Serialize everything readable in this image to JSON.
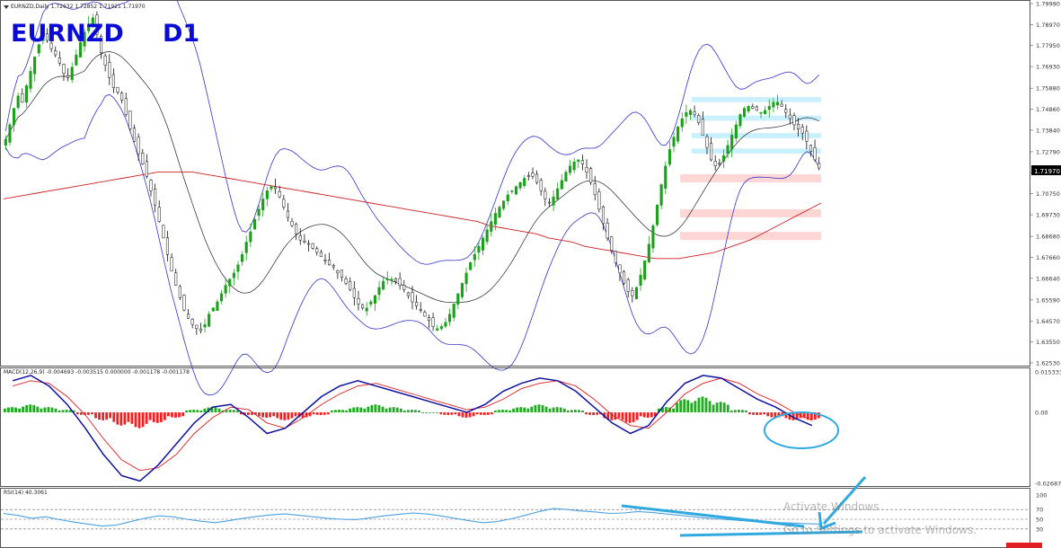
{
  "symbol_label": "EURNZD",
  "timeframe_label": "D1",
  "main_panel": {
    "title": "EURNZD,Daily",
    "ohlc": "1.72632 1.72852 1.71921 1.71970",
    "current_price": "1.71970",
    "price_ticks": [
      "1.79990",
      "1.78970",
      "1.77950",
      "1.76930",
      "1.75880",
      "1.74860",
      "1.73840",
      "1.72790",
      "1.71770",
      "1.70750",
      "1.69730",
      "1.68680",
      "1.67660",
      "1.66640",
      "1.65590",
      "1.64570",
      "1.63550",
      "1.62530"
    ]
  },
  "macd_panel": {
    "label": "MACD(12,26,9) -0.004693 -0.003515 0.000000 -0.001178 -0.001178",
    "ticks": [
      "0.015333",
      "0.00",
      "-0.026879"
    ]
  },
  "rsi_panel": {
    "label": "RSI(14) 40.3061",
    "ticks": [
      "100",
      "70",
      "50",
      "30"
    ]
  },
  "watermark": {
    "line1": "Activate Windows",
    "line2": "Go to Settings to activate Windows."
  },
  "colors": {
    "bull_candle": "#1aa01a",
    "bear_candle": "#111111",
    "bollinger": "#3333cc",
    "sma_long": "#cc2020",
    "macd_line": "#1010a0",
    "signal_line": "#e02020",
    "macd_hist_pos": "#22aa22",
    "macd_hist_neg": "#ee2222",
    "rsi_line": "#4aa0e0",
    "annotation": "#30a8e0",
    "resistance_zone": "#c8f0ff",
    "support_zone": "#ffd6d6",
    "label_blue": "#0a0ad8"
  },
  "chart_data": [
    {
      "type": "candlestick",
      "panel": "price",
      "title": "EURNZD,Daily",
      "ylim": [
        1.6253,
        1.7999
      ],
      "close": [
        1.734,
        1.741,
        1.749,
        1.755,
        1.752,
        1.76,
        1.767,
        1.774,
        1.78,
        1.785,
        1.782,
        1.778,
        1.775,
        1.771,
        1.766,
        1.764,
        1.769,
        1.775,
        1.781,
        1.786,
        1.79,
        1.793,
        1.785,
        1.776,
        1.77,
        1.764,
        1.759,
        1.757,
        1.753,
        1.746,
        1.739,
        1.733,
        1.727,
        1.722,
        1.716,
        1.709,
        1.702,
        1.694,
        1.686,
        1.678,
        1.67,
        1.663,
        1.657,
        1.651,
        1.647,
        1.644,
        1.642,
        1.641,
        1.644,
        1.649,
        1.652,
        1.655,
        1.659,
        1.663,
        1.666,
        1.669,
        1.673,
        1.678,
        1.684,
        1.689,
        1.695,
        1.7,
        1.705,
        1.709,
        1.711,
        1.71,
        1.706,
        1.701,
        1.696,
        1.692,
        1.688,
        1.685,
        1.684,
        1.683,
        1.681,
        1.679,
        1.677,
        1.675,
        1.673,
        1.672,
        1.669,
        1.667,
        1.664,
        1.661,
        1.657,
        1.654,
        1.652,
        1.652,
        1.655,
        1.658,
        1.662,
        1.665,
        1.666,
        1.666,
        1.665,
        1.663,
        1.661,
        1.658,
        1.655,
        1.653,
        1.651,
        1.648,
        1.646,
        1.643,
        1.642,
        1.643,
        1.645,
        1.649,
        1.654,
        1.659,
        1.664,
        1.669,
        1.674,
        1.678,
        1.682,
        1.686,
        1.69,
        1.694,
        1.698,
        1.701,
        1.704,
        1.707,
        1.709,
        1.711,
        1.713,
        1.715,
        1.716,
        1.716,
        1.713,
        1.709,
        1.705,
        1.703,
        1.706,
        1.71,
        1.714,
        1.718,
        1.721,
        1.723,
        1.724,
        1.722,
        1.718,
        1.713,
        1.707,
        1.7,
        1.693,
        1.686,
        1.68,
        1.674,
        1.669,
        1.664,
        1.66,
        1.658,
        1.662,
        1.668,
        1.675,
        1.683,
        1.692,
        1.702,
        1.712,
        1.721,
        1.729,
        1.735,
        1.74,
        1.744,
        1.747,
        1.748,
        1.746,
        1.742,
        1.736,
        1.73,
        1.724,
        1.721,
        1.722,
        1.726,
        1.731,
        1.736,
        1.741,
        1.746,
        1.749,
        1.75,
        1.749,
        1.748,
        1.747,
        1.748,
        1.75,
        1.752,
        1.752,
        1.75,
        1.747,
        1.744,
        1.741,
        1.739,
        1.737,
        1.733,
        1.728,
        1.724,
        1.72
      ],
      "ma_long": [
        1.705,
        1.706,
        1.707,
        1.708,
        1.709,
        1.71,
        1.711,
        1.712,
        1.713,
        1.714,
        1.715,
        1.716,
        1.717,
        1.718,
        1.718,
        1.718,
        1.718,
        1.717,
        1.716,
        1.715,
        1.714,
        1.713,
        1.712,
        1.711,
        1.71,
        1.709,
        1.708,
        1.707,
        1.706,
        1.705,
        1.704,
        1.703,
        1.702,
        1.701,
        1.7,
        1.699,
        1.698,
        1.697,
        1.696,
        1.695,
        1.694,
        1.692,
        1.691,
        1.69,
        1.689,
        1.688,
        1.686,
        1.685,
        1.684,
        1.682,
        1.681,
        1.68,
        1.679,
        1.678,
        1.677,
        1.676,
        1.676,
        1.676,
        1.677,
        1.678,
        1.679,
        1.681,
        1.683,
        1.685,
        1.688,
        1.691,
        1.694,
        1.697,
        1.7,
        1.703
      ],
      "annotations": [
        "resistance zones (light blue)",
        "support zones (pink)"
      ]
    },
    {
      "type": "bar",
      "panel": "macd",
      "title": "MACD(12,26,9) -0.004693 -0.003515 0.000000 -0.001178 -0.001178",
      "ylim": [
        -0.026879,
        0.015333
      ],
      "histogram": [
        0.002,
        0.003,
        0.002,
        0.001,
        -0.001,
        -0.003,
        -0.005,
        -0.006,
        -0.004,
        -0.002,
        0.001,
        0.002,
        0.001,
        -0.001,
        -0.002,
        -0.003,
        -0.002,
        -0.001,
        0.001,
        0.002,
        0.003,
        0.002,
        0.001,
        0.0,
        -0.001,
        -0.002,
        -0.001,
        0.001,
        0.002,
        0.003,
        0.002,
        0.001,
        -0.001,
        -0.003,
        -0.004,
        -0.002,
        0.002,
        0.005,
        0.006,
        0.004,
        0.001,
        -0.001,
        -0.002,
        -0.003,
        -0.003
      ],
      "macd_line": [
        0.012,
        0.014,
        0.01,
        0.003,
        -0.006,
        -0.016,
        -0.024,
        -0.026,
        -0.02,
        -0.012,
        -0.004,
        0.002,
        0.003,
        -0.002,
        -0.008,
        -0.006,
        0.0,
        0.006,
        0.01,
        0.012,
        0.01,
        0.008,
        0.006,
        0.004,
        0.002,
        0.0,
        0.003,
        0.008,
        0.011,
        0.013,
        0.012,
        0.008,
        0.002,
        -0.004,
        -0.008,
        -0.005,
        0.004,
        0.011,
        0.014,
        0.013,
        0.009,
        0.005,
        0.002,
        -0.002,
        -0.005
      ],
      "signal_line": [
        0.01,
        0.012,
        0.011,
        0.006,
        -0.001,
        -0.01,
        -0.018,
        -0.022,
        -0.021,
        -0.016,
        -0.008,
        -0.002,
        0.002,
        0.001,
        -0.004,
        -0.006,
        -0.002,
        0.003,
        0.007,
        0.01,
        0.011,
        0.009,
        0.007,
        0.005,
        0.003,
        0.001,
        0.002,
        0.005,
        0.009,
        0.011,
        0.012,
        0.01,
        0.005,
        -0.001,
        -0.005,
        -0.006,
        0.0,
        0.007,
        0.011,
        0.013,
        0.011,
        0.007,
        0.004,
        0.0,
        -0.003
      ]
    },
    {
      "type": "line",
      "panel": "rsi",
      "title": "RSI(14) 40.3061",
      "ylim": [
        0,
        100
      ],
      "levels": [
        70,
        50,
        30
      ],
      "values": [
        62,
        58,
        52,
        55,
        49,
        44,
        40,
        36,
        38,
        45,
        52,
        57,
        55,
        50,
        46,
        43,
        47,
        52,
        56,
        59,
        61,
        58,
        55,
        52,
        50,
        49,
        53,
        57,
        60,
        63,
        61,
        57,
        52,
        47,
        43,
        45,
        51,
        58,
        66,
        72,
        70,
        67,
        65,
        62,
        63,
        66,
        64,
        61,
        58,
        55,
        52,
        50,
        48,
        46,
        44,
        43,
        42,
        41,
        40
      ]
    }
  ]
}
